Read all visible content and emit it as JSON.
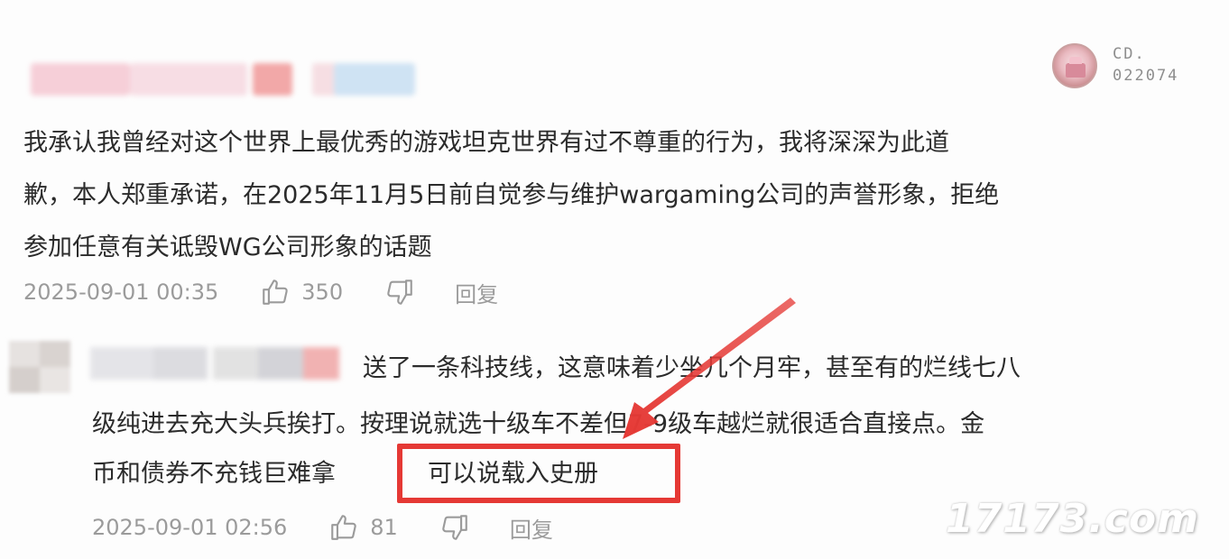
{
  "comments": [
    {
      "badge": {
        "line1": "CD.",
        "line2": "022074"
      },
      "text_lines": [
        "我承认我曾经对这个世界上最优秀的游戏坦克世界有过不尊重的行为，我将深深为此道",
        "歉，本人郑重承诺，在2025年11月5日前自觉参与维护wargaming公司的声誉形象，拒绝",
        "参加任意有关诋毁WG公司形象的话题"
      ],
      "timestamp": "2025-09-01 00:35",
      "likes": "350",
      "reply_label": "回复"
    },
    {
      "text_lines": [
        "送了一条科技线，这意味着少坐几个月牢，甚至有的烂线七八",
        "级纯进去充大头兵挨打。按理说就选十级车不差但7-9级车越烂就很适合直接点。金",
        "币和债券不充钱巨难拿"
      ],
      "highlighted_text": "可以说载入史册",
      "timestamp": "2025-09-01 02:56",
      "likes": "81",
      "reply_label": "回复"
    }
  ],
  "watermark": "17173.com",
  "colors": {
    "highlight": "#e53935",
    "meta_text": "#9b9b9b",
    "body_text": "#2b2b2b"
  }
}
